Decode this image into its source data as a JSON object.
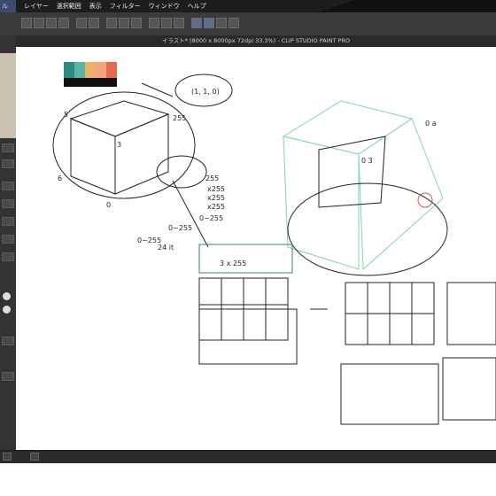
{
  "app": {
    "menu_left": "ル",
    "menus": [
      "レイヤー",
      "選択範囲",
      "表示",
      "フィルター",
      "ウィンドウ",
      "ヘルプ"
    ],
    "window_title": "イラスト* (8000 x 8000px 72dpi 33.3%) - CLIP STUDIO PAINT PRO"
  },
  "palette": {
    "colors": [
      "#2e8b7f",
      "#5cb3a6",
      "#e8b46a",
      "#f3a37e",
      "#e46a4e"
    ]
  },
  "sketch": {
    "left_cube_coord": "(1, 1, 0)",
    "values_a": "255",
    "values_b": "255",
    "rgb_stack": [
      "255",
      "x255",
      "x255",
      "x255"
    ],
    "range_labels": [
      "0~255",
      "0~255",
      "0~255"
    ],
    "cube_labels": [
      "3",
      "6",
      "5",
      "0"
    ],
    "right_label_a": "0 a",
    "right_label_b": "0 3",
    "bit": "24 it",
    "mid_text": "3 x 255"
  }
}
